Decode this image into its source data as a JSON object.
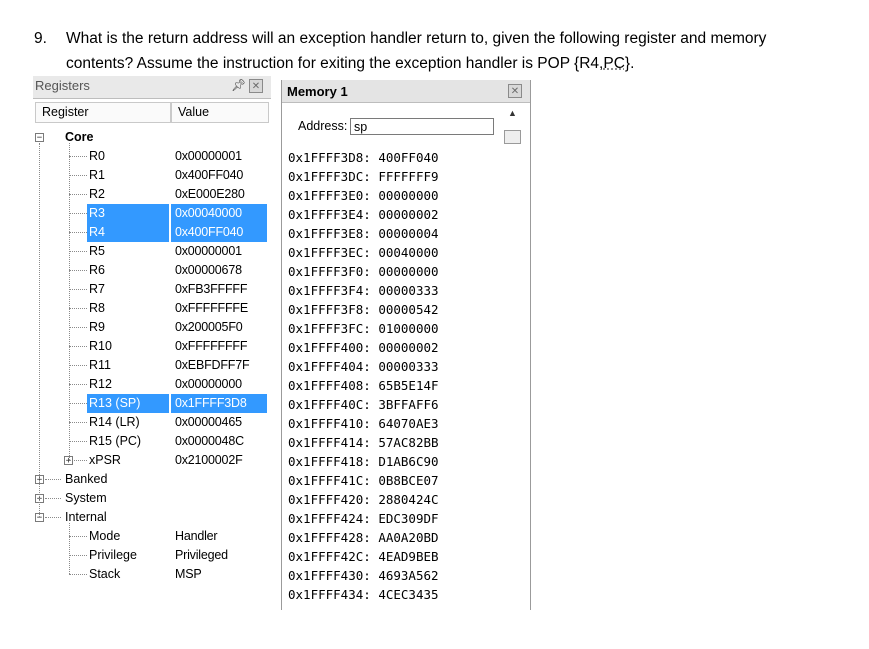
{
  "question": {
    "number": "9.",
    "line1": "What is the return address will an exception handler return to, given the following register and memory",
    "line2_prefix": "contents? Assume the instruction for exiting the exception handler is POP {R4,",
    "line2_pc": "PC",
    "line2_suffix": "}."
  },
  "registers_panel": {
    "title": "Registers",
    "pin_icon": "pin-icon",
    "close_icon": "close-icon",
    "col_register": "Register",
    "col_value": "Value",
    "groups": {
      "core": "Core",
      "banked": "Banked",
      "system": "System",
      "internal": "Internal"
    },
    "core_rows": [
      {
        "name": "R0",
        "value": "0x00000001",
        "highlighted": false
      },
      {
        "name": "R1",
        "value": "0x400FF040",
        "highlighted": false
      },
      {
        "name": "R2",
        "value": "0xE000E280",
        "highlighted": false
      },
      {
        "name": "R3",
        "value": "0x00040000",
        "highlighted": true
      },
      {
        "name": "R4",
        "value": "0x400FF040",
        "highlighted": true
      },
      {
        "name": "R5",
        "value": "0x00000001",
        "highlighted": false
      },
      {
        "name": "R6",
        "value": "0x00000678",
        "highlighted": false
      },
      {
        "name": "R7",
        "value": "0xFB3FFFFF",
        "highlighted": false
      },
      {
        "name": "R8",
        "value": "0xFFFFFFFE",
        "highlighted": false
      },
      {
        "name": "R9",
        "value": "0x200005F0",
        "highlighted": false
      },
      {
        "name": "R10",
        "value": "0xFFFFFFFF",
        "highlighted": false
      },
      {
        "name": "R11",
        "value": "0xEBFDFF7F",
        "highlighted": false
      },
      {
        "name": "R12",
        "value": "0x00000000",
        "highlighted": false
      },
      {
        "name": "R13 (SP)",
        "value": "0x1FFFF3D8",
        "highlighted": true
      },
      {
        "name": "R14 (LR)",
        "value": "0x00000465",
        "highlighted": false
      },
      {
        "name": "R15 (PC)",
        "value": "0x0000048C",
        "highlighted": false
      },
      {
        "name": "xPSR",
        "value": "0x2100002F",
        "highlighted": false
      }
    ],
    "internal_rows": [
      {
        "name": "Mode",
        "value": "Handler"
      },
      {
        "name": "Privilege",
        "value": "Privileged"
      },
      {
        "name": "Stack",
        "value": "MSP"
      }
    ],
    "highlight_color": "#3399ff"
  },
  "memory_panel": {
    "title": "Memory 1",
    "address_label": "Address:",
    "address_value": "sp",
    "rows": [
      {
        "addr": "0x1FFFF3D8:",
        "value": "400FF040"
      },
      {
        "addr": "0x1FFFF3DC:",
        "value": "FFFFFFF9"
      },
      {
        "addr": "0x1FFFF3E0:",
        "value": "00000000"
      },
      {
        "addr": "0x1FFFF3E4:",
        "value": "00000002"
      },
      {
        "addr": "0x1FFFF3E8:",
        "value": "00000004"
      },
      {
        "addr": "0x1FFFF3EC:",
        "value": "00040000"
      },
      {
        "addr": "0x1FFFF3F0:",
        "value": "00000000"
      },
      {
        "addr": "0x1FFFF3F4:",
        "value": "00000333"
      },
      {
        "addr": "0x1FFFF3F8:",
        "value": "00000542"
      },
      {
        "addr": "0x1FFFF3FC:",
        "value": "01000000"
      },
      {
        "addr": "0x1FFFF400:",
        "value": "00000002"
      },
      {
        "addr": "0x1FFFF404:",
        "value": "00000333"
      },
      {
        "addr": "0x1FFFF408:",
        "value": "65B5E14F"
      },
      {
        "addr": "0x1FFFF40C:",
        "value": "3BFFAFF6"
      },
      {
        "addr": "0x1FFFF410:",
        "value": "64070AE3"
      },
      {
        "addr": "0x1FFFF414:",
        "value": "57AC82BB"
      },
      {
        "addr": "0x1FFFF418:",
        "value": "D1AB6C90"
      },
      {
        "addr": "0x1FFFF41C:",
        "value": "0B8BCE07"
      },
      {
        "addr": "0x1FFFF420:",
        "value": "2880424C"
      },
      {
        "addr": "0x1FFFF424:",
        "value": "EDC309DF"
      },
      {
        "addr": "0x1FFFF428:",
        "value": "AA0A20BD"
      },
      {
        "addr": "0x1FFFF42C:",
        "value": "4EAD9BEB"
      },
      {
        "addr": "0x1FFFF430:",
        "value": "4693A562"
      },
      {
        "addr": "0x1FFFF434:",
        "value": "4CEC3435"
      }
    ]
  }
}
